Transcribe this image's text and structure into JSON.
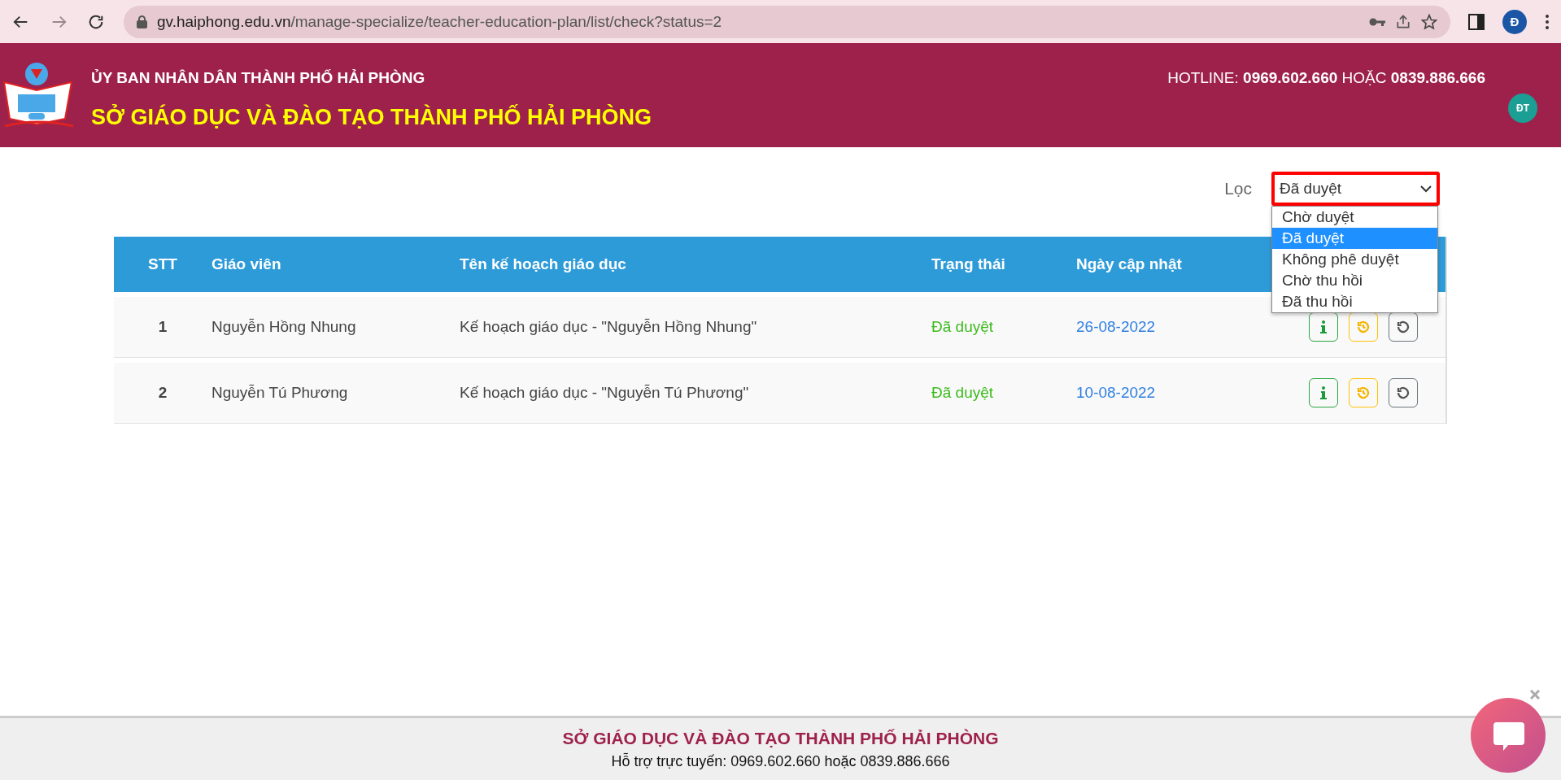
{
  "browser": {
    "url_host": "gv.haiphong.edu.vn",
    "url_path": "/manage-specialize/teacher-education-plan/list/check?status=2",
    "profile": "Đ"
  },
  "header": {
    "authority": "ỦY BAN NHÂN DÂN THÀNH PHỐ HẢI PHÒNG",
    "title": "SỞ GIÁO DỤC VÀ ĐÀO TẠO THÀNH PHỐ HẢI PHÒNG",
    "hotline": "HOTLINE: **0969.602.660** HOẶC **0839.886.666**",
    "avatar": "ĐT"
  },
  "filter": {
    "label": "Lọc",
    "value": "Đã duyệt",
    "expanded": true,
    "options": [
      {
        "label": "Chờ duyệt",
        "selected": false
      },
      {
        "label": "Đã duyệt",
        "selected": true
      },
      {
        "label": "Không phê duyệt",
        "selected": false
      },
      {
        "label": "Chờ thu hồi",
        "selected": false
      },
      {
        "label": "Đã thu hồi",
        "selected": false
      }
    ]
  },
  "table": {
    "columns": [
      "STT",
      "Giáo viên",
      "Tên kế hoạch giáo dục",
      "Trạng thái",
      "Ngày cập nhật"
    ],
    "rows": [
      {
        "stt": "1",
        "teacher": "Nguyễn Hồng Nhung",
        "plan": "Kế hoạch giáo dục - \"Nguyễn Hồng Nhung\"",
        "status": "Đã duyệt",
        "date": "26-08-2022"
      },
      {
        "stt": "2",
        "teacher": "Nguyễn Tú Phương",
        "plan": "Kế hoạch giáo dục - \"Nguyễn Tú Phương\"",
        "status": "Đã duyệt",
        "date": "10-08-2022"
      }
    ]
  },
  "footer": {
    "title": "SỞ GIÁO DỤC VÀ ĐÀO TẠO THÀNH PHỐ HẢI PHÒNG",
    "support": "Hỗ trợ trực tuyến: 0969.602.660 hoặc 0839.886.666"
  }
}
